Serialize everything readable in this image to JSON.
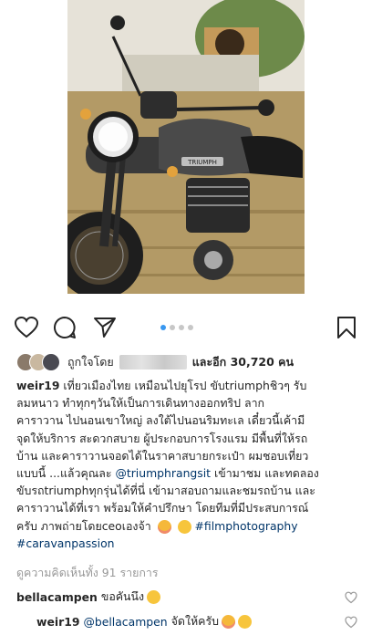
{
  "post": {
    "image_alt": "Triumph Street Twin motorcycle on dry grass",
    "image_brand": "TRIUMPH",
    "carousel": {
      "count": 4,
      "active": 1
    }
  },
  "actions": {
    "like_icon": "heart-icon",
    "comment_icon": "comment-bubble-icon",
    "share_icon": "paper-plane-icon",
    "save_icon": "bookmark-icon"
  },
  "likes": {
    "prefix": "ถูกใจโดย",
    "suffix": "และอีก 30,720 คน"
  },
  "caption": {
    "username": "weir19",
    "lines": [
      " เที่ยวเมืองไทย เหมือนไปยุโรป ขับtriumphชิวๆ รับ",
      "ลมหนาว ทำทุกๆวันให้เป็นการเดินทางออกทริป ลาก",
      "คาราวาน ไปนอนเขาใหญ่ ลงใต้ไปนอนริมทะเล เดี๋ยวนี้เค้ามี",
      "จุดให้บริการ สะดวกสบาย ผู้ประกอบการโรงแรม มีพื้นที่ให้รถ",
      "บ้าน และคาราวานจอดได้ในราคาสบายกระเป๋า ผมชอบเที่ยว"
    ],
    "line6_before": "แบบนี้ ...แล้วคุณละ ",
    "mention": "@triumphrangsit",
    "line6_after": " เข้ามาชม และทดลอง",
    "line7": "ขับรถtriumphทุกรุ่นได้ที่นี่ เข้ามาสอบถามและชมรถบ้าน และ",
    "line8": "คาราวานได้ที่เรา พร้อมให้คำปรึกษา โดยทีมที่มีประสบการณ์",
    "line9_before": "ครับ ภาพถ่ายโดยceoเองจ้า",
    "hashtag1": "#filmphotography",
    "hashtag2": "#caravanpassion"
  },
  "view_comments": "ดูความคิดเห็นทั้ง 91 รายการ",
  "comments": [
    {
      "username": "bellacampen",
      "text": "ขอคันนึง"
    },
    {
      "username": "weir19",
      "mention": "@bellacampen",
      "text": "จัดให้ครับ"
    }
  ],
  "colors": {
    "text": "#262626",
    "link": "#003569",
    "muted": "#999999",
    "carousel_active": "#3897f0"
  }
}
